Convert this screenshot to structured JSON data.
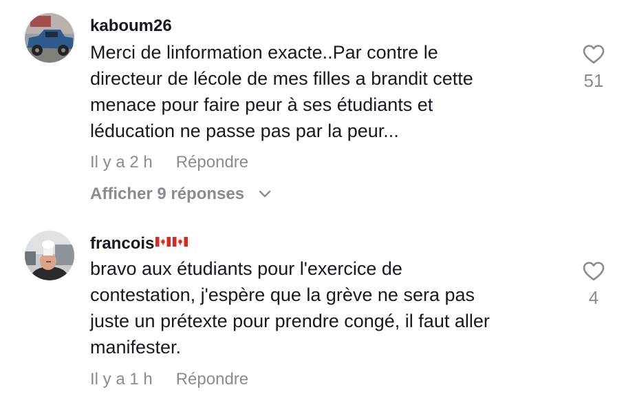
{
  "comments": [
    {
      "username": "kaboum26",
      "text": "Merci de linformation exacte..Par contre le\ndirecteur de lécole de mes filles a brandit cette\nmenace pour faire peur à ses étudiants et\nléducation ne passe pas par la peur...",
      "time": "Il y a 2 h",
      "reply_label": "Répondre",
      "likes": "51",
      "show_replies_label": "Afficher 9 réponses",
      "avatar_icon": "truck-photo-avatar"
    },
    {
      "username": "francois",
      "username_suffix_icon": "canada-flag-icon",
      "text": "bravo aux étudiants pour l'exercice de\ncontestation, j'espère que la grève ne sera pas\njuste un prétexte pour prendre congé, il faut aller\nmanifester.",
      "time": "Il y a 1 h",
      "reply_label": "Répondre",
      "likes": "4",
      "avatar_icon": "person-chef-hat-avatar"
    }
  ],
  "colors": {
    "primary_text": "#161823",
    "secondary_text": "#8a8b91",
    "background": "#ffffff"
  }
}
